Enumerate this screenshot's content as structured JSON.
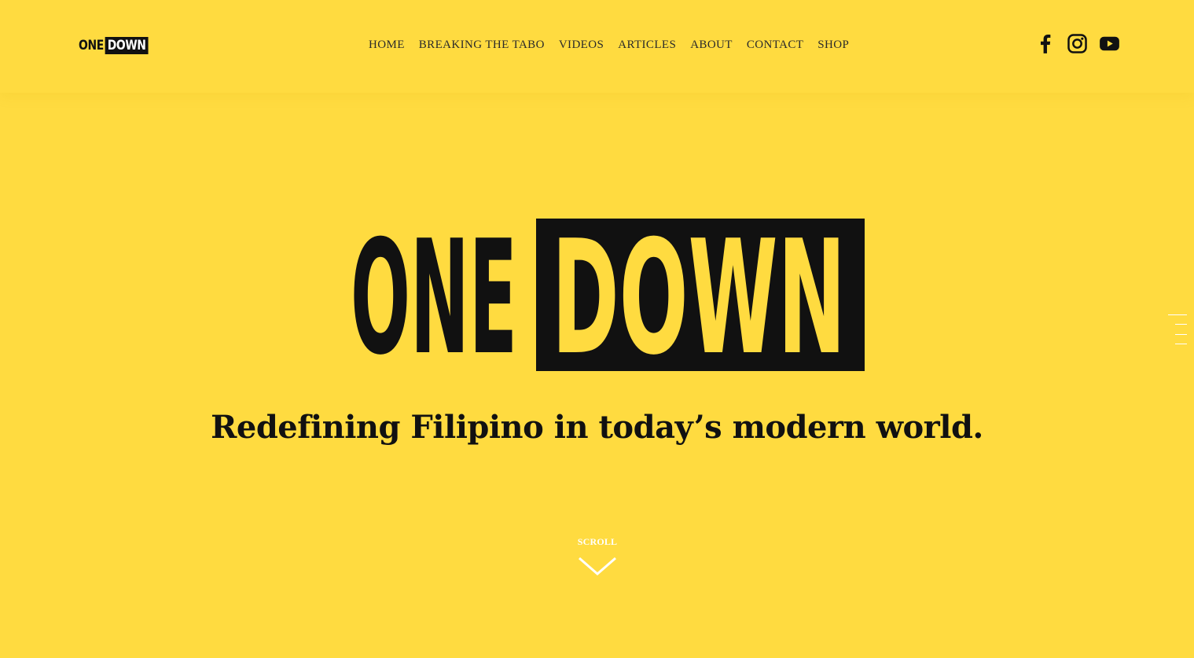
{
  "brand": {
    "logo_one": "ONE",
    "logo_down": "DOWN"
  },
  "nav": {
    "items": [
      {
        "label": "HOME"
      },
      {
        "label": "BREAKING THE TABO"
      },
      {
        "label": "VIDEOS"
      },
      {
        "label": "ARTICLES"
      },
      {
        "label": "ABOUT"
      },
      {
        "label": "CONTACT"
      },
      {
        "label": "SHOP"
      }
    ]
  },
  "social": {
    "icons": [
      "facebook-icon",
      "instagram-icon",
      "youtube-icon"
    ]
  },
  "hero": {
    "logo_one": "ONE",
    "logo_down": "DOWN",
    "tagline": "Redefining Filipino in today’s modern world."
  },
  "scroll": {
    "label": "SCROLL"
  },
  "colors": {
    "background": "#FFDB40",
    "ink": "#111111",
    "white": "#FFFFFF"
  }
}
